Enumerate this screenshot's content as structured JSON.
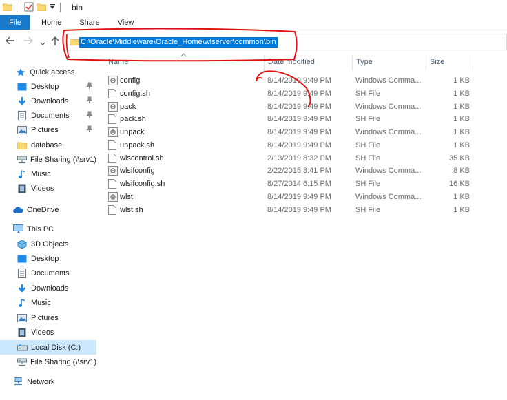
{
  "window": {
    "title": "bin"
  },
  "ribbon": {
    "tabs": [
      "File",
      "Home",
      "Share",
      "View"
    ]
  },
  "address": {
    "path": "C:\\Oracle\\Middleware\\Oracle_Home\\wlserver\\common\\bin"
  },
  "columns": {
    "name": "Name",
    "date": "Date modified",
    "type": "Type",
    "size": "Size"
  },
  "sidebar": {
    "items": [
      {
        "label": "Quick access",
        "icon": "star-icon",
        "pinned": false
      },
      {
        "label": "Desktop",
        "icon": "desktop-folder-icon",
        "pinned": true
      },
      {
        "label": "Downloads",
        "icon": "download-arrow-icon",
        "pinned": true
      },
      {
        "label": "Documents",
        "icon": "documents-icon",
        "pinned": true
      },
      {
        "label": "Pictures",
        "icon": "pictures-icon",
        "pinned": true
      },
      {
        "label": "database",
        "icon": "folder-icon",
        "pinned": false
      },
      {
        "label": "File Sharing (\\\\srv1)",
        "icon": "network-drive-icon",
        "pinned": false
      },
      {
        "label": "Music",
        "icon": "music-note-icon",
        "pinned": false
      },
      {
        "label": "Videos",
        "icon": "videos-icon",
        "pinned": false
      },
      {
        "label": "OneDrive",
        "icon": "cloud-icon",
        "pinned": false
      },
      {
        "label": "This PC",
        "icon": "computer-icon",
        "pinned": false
      },
      {
        "label": "3D Objects",
        "icon": "cube-icon",
        "pinned": false
      },
      {
        "label": "Desktop",
        "icon": "desktop-folder-icon",
        "pinned": false
      },
      {
        "label": "Documents",
        "icon": "documents-icon",
        "pinned": false
      },
      {
        "label": "Downloads",
        "icon": "download-arrow-icon",
        "pinned": false
      },
      {
        "label": "Music",
        "icon": "music-note-icon",
        "pinned": false
      },
      {
        "label": "Pictures",
        "icon": "pictures-icon",
        "pinned": false
      },
      {
        "label": "Videos",
        "icon": "videos-icon",
        "pinned": false
      },
      {
        "label": "Local Disk (C:)",
        "icon": "disk-icon",
        "pinned": false
      },
      {
        "label": "File Sharing (\\\\srv1)",
        "icon": "network-drive-icon",
        "pinned": false
      },
      {
        "label": "Network",
        "icon": "network-icon",
        "pinned": false
      }
    ]
  },
  "files": [
    {
      "name": "config",
      "date": "8/14/2019 9:49 PM",
      "type": "Windows Comma...",
      "size": "1 KB",
      "icon": "cmd-file-icon"
    },
    {
      "name": "config.sh",
      "date": "8/14/2019 9:49 PM",
      "type": "SH File",
      "size": "1 KB",
      "icon": "file-icon"
    },
    {
      "name": "pack",
      "date": "8/14/2019 9:49 PM",
      "type": "Windows Comma...",
      "size": "1 KB",
      "icon": "cmd-file-icon"
    },
    {
      "name": "pack.sh",
      "date": "8/14/2019 9:49 PM",
      "type": "SH File",
      "size": "1 KB",
      "icon": "file-icon"
    },
    {
      "name": "unpack",
      "date": "8/14/2019 9:49 PM",
      "type": "Windows Comma...",
      "size": "1 KB",
      "icon": "cmd-file-icon"
    },
    {
      "name": "unpack.sh",
      "date": "8/14/2019 9:49 PM",
      "type": "SH File",
      "size": "1 KB",
      "icon": "file-icon"
    },
    {
      "name": "wlscontrol.sh",
      "date": "2/13/2019 8:32 PM",
      "type": "SH File",
      "size": "35 KB",
      "icon": "file-icon"
    },
    {
      "name": "wlsifconfig",
      "date": "2/22/2015 8:41 PM",
      "type": "Windows Comma...",
      "size": "8 KB",
      "icon": "cmd-file-icon"
    },
    {
      "name": "wlsifconfig.sh",
      "date": "8/27/2014 6:15 PM",
      "type": "SH File",
      "size": "16 KB",
      "icon": "file-icon"
    },
    {
      "name": "wlst",
      "date": "8/14/2019 9:49 PM",
      "type": "Windows Comma...",
      "size": "1 KB",
      "icon": "cmd-file-icon"
    },
    {
      "name": "wlst.sh",
      "date": "8/14/2019 9:49 PM",
      "type": "SH File",
      "size": "1 KB",
      "icon": "file-icon"
    }
  ],
  "colors": {
    "accent": "#1979ca",
    "selection": "#0078d7",
    "annotation": "#e01010",
    "nav_selected": "#cce8ff"
  }
}
